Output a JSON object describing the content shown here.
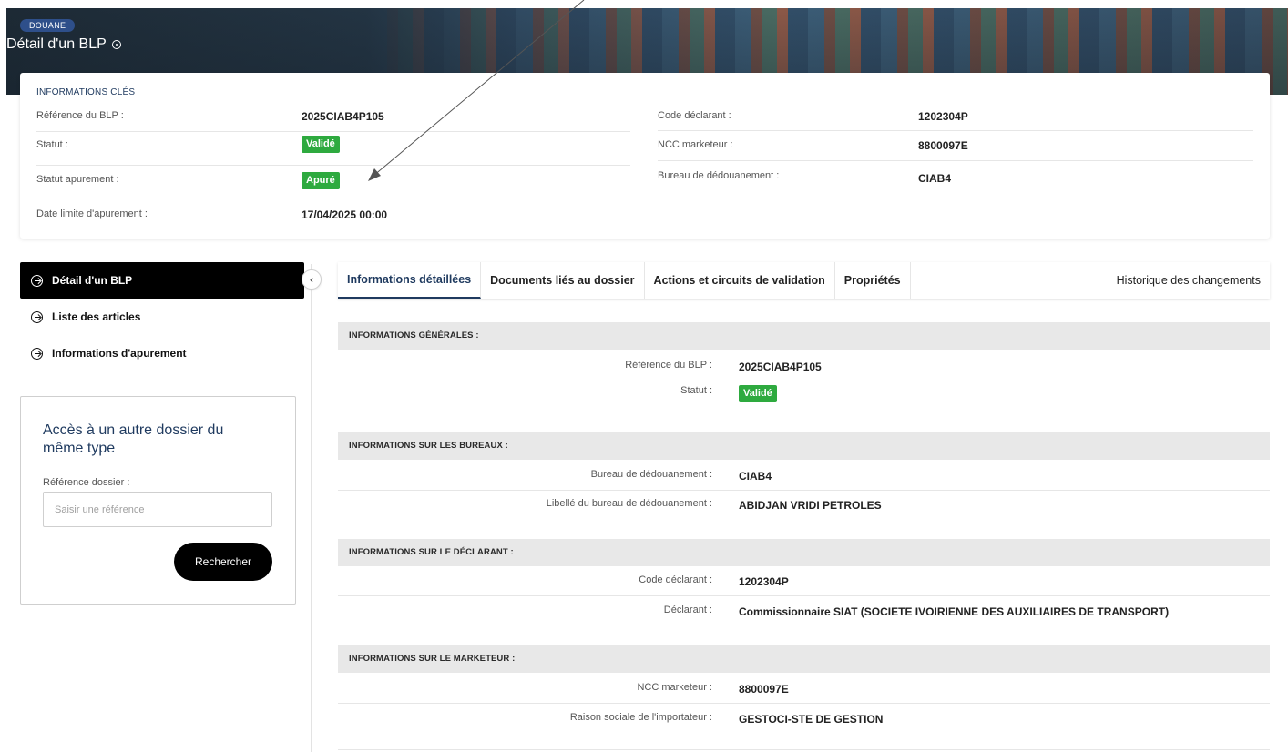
{
  "header": {
    "department": "DOUANE",
    "title": "Détail d'un BLP"
  },
  "key_info": {
    "heading": "INFORMATIONS CLÉS",
    "left": [
      {
        "label": "Référence du BLP :",
        "value": "2025CIAB4P105"
      },
      {
        "label": "Statut :",
        "value": "Validé",
        "badge": true
      },
      {
        "label": "Statut apurement :",
        "value": "Apuré",
        "badge": true
      },
      {
        "label": "Date limite d'apurement :",
        "value": "17/04/2025 00:00"
      }
    ],
    "right": [
      {
        "label": "Code déclarant :",
        "value": "1202304P"
      },
      {
        "label": "NCC marketeur :",
        "value": "8800097E"
      },
      {
        "label": "Bureau de dédouanement :",
        "value": "CIAB4"
      }
    ]
  },
  "sidebar": {
    "items": [
      {
        "label": "Détail d'un BLP",
        "active": true
      },
      {
        "label": "Liste des articles",
        "active": false
      },
      {
        "label": "Informations d'apurement",
        "active": false
      }
    ]
  },
  "access_box": {
    "title": "Accès à un autre dossier du même type",
    "field_label": "Référence dossier :",
    "placeholder": "Saisir une référence",
    "value": "",
    "button_label": "Rechercher"
  },
  "tabs": [
    {
      "label": "Informations détaillées",
      "active": true
    },
    {
      "label": "Documents liés au dossier",
      "active": false
    },
    {
      "label": "Actions et circuits de validation",
      "active": false
    },
    {
      "label": "Propriétés",
      "active": false
    },
    {
      "label": "Historique des changements",
      "active": false
    }
  ],
  "sections": {
    "general": {
      "title": "INFORMATIONS GÉNÉRALES :",
      "rows": [
        {
          "label": "Référence du BLP :",
          "value": "2025CIAB4P105"
        },
        {
          "label": "Statut :",
          "value": "Validé"
        }
      ]
    },
    "offices": {
      "title": "INFORMATIONS SUR LES BUREAUX :",
      "rows": [
        {
          "label": "Bureau de dédouanement :",
          "value": "CIAB4"
        },
        {
          "label": "Libellé du bureau de dédouanement :",
          "value": "ABIDJAN VRIDI PETROLES"
        }
      ]
    },
    "declarant": {
      "title": "INFORMATIONS SUR LE DÉCLARANT :",
      "rows": [
        {
          "label": "Code déclarant :",
          "value": "1202304P"
        },
        {
          "label": "Déclarant :",
          "value": "Commissionnaire SIAT (SOCIETE IVOIRIENNE DES AUXILIAIRES DE TRANSPORT)"
        }
      ]
    },
    "marketer": {
      "title": "INFORMATIONS SUR LE MARKETEUR :",
      "rows": [
        {
          "label": "NCC marketeur :",
          "value": "8800097E"
        },
        {
          "label": "Raison sociale de l'importateur :",
          "value": "GESTOCI-STE DE GESTION"
        }
      ]
    }
  },
  "colors": {
    "accent_navy": "#1f3a5f",
    "badge_green": "#2eaa3f",
    "active_nav_bg": "#000000",
    "section_head_bg": "#e8e8e8"
  },
  "icons": {
    "title_info": "info-circle-icon",
    "nav_item": "arrow-right-circle-icon",
    "collapse": "chevron-left-icon"
  }
}
